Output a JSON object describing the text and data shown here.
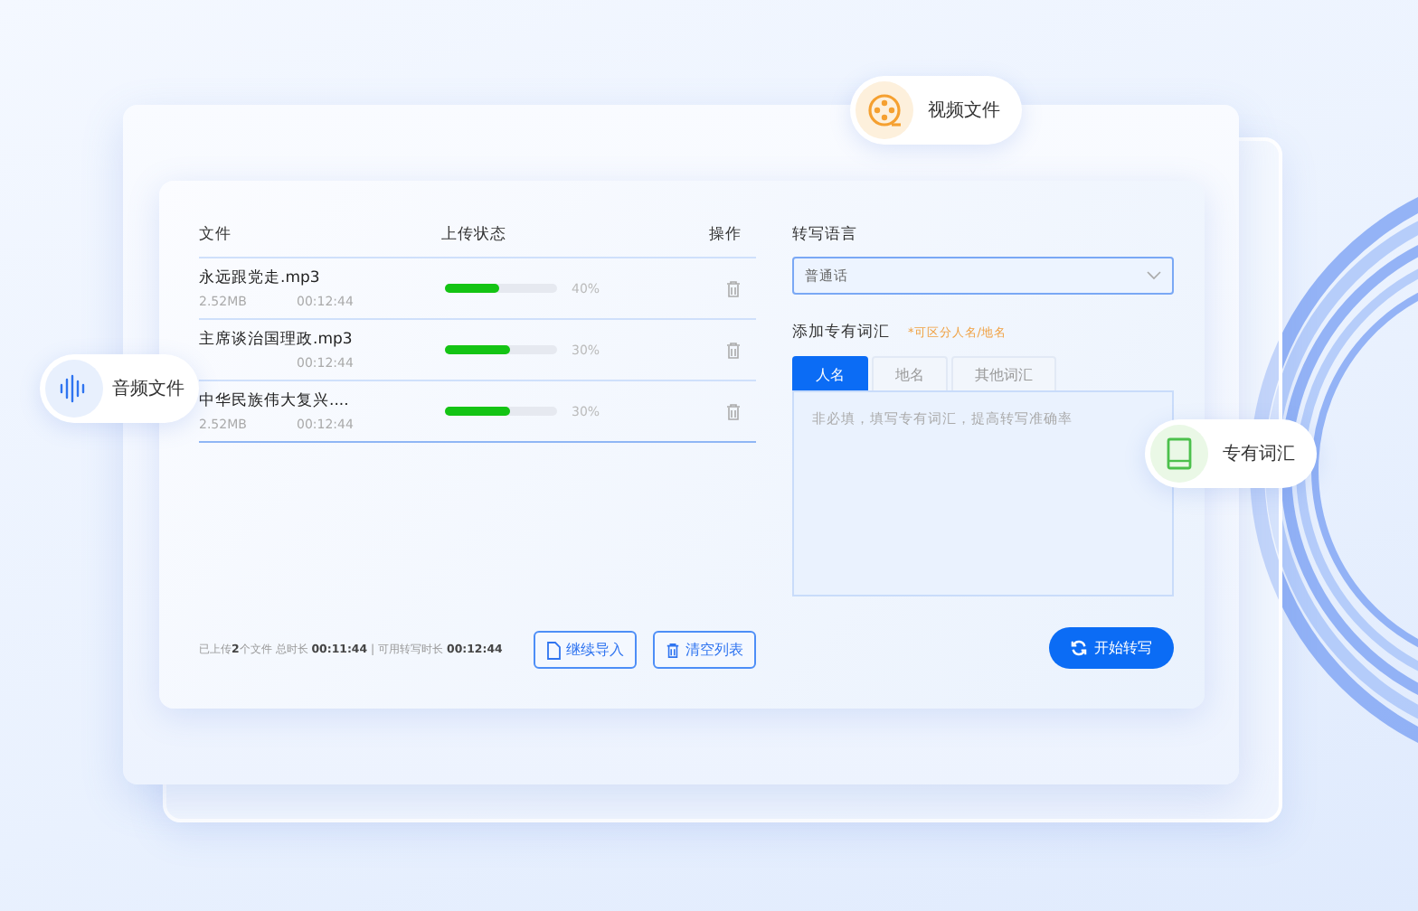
{
  "file_table": {
    "columns": [
      "文件",
      "上传状态",
      "操作"
    ],
    "rows": [
      {
        "name": "永远跟党走.mp3",
        "size": "2.52MB",
        "duration": "00:12:44",
        "level": 0.48,
        "percent": "40%"
      },
      {
        "name": "主席谈治国理政.mp3",
        "duration": "00:12:44",
        "level": 0.58,
        "percent": "30%"
      },
      {
        "name": "中华民族伟大复兴....",
        "size": "2.52MB",
        "duration": "00:12:44",
        "level": 0.58,
        "percent": "30%"
      }
    ]
  },
  "footer": {
    "summary": "已上传**2**个文件 总时长 **00:11:44** | 可用转写时长 **00:12:44**",
    "buttons": [
      "继续导入",
      "清空列表"
    ]
  },
  "language": {
    "label": "转写语言",
    "value": "普通话"
  },
  "terms": {
    "label": "添加专有词汇",
    "hint": "*可区分人名/地名",
    "tabs": [
      {
        "label": "人名",
        "selected": true
      },
      {
        "label": "地名",
        "selected": false
      },
      {
        "label": "其他词汇",
        "selected": false
      }
    ],
    "placeholder": "非必填，填写专有词汇，提高转写准确率"
  },
  "start_button": "开始转写",
  "badges": [
    {
      "kind": "video",
      "label": "视频文件"
    },
    {
      "kind": "audio",
      "label": "音频文件"
    },
    {
      "kind": "glossary",
      "label": "专有词汇"
    }
  ]
}
